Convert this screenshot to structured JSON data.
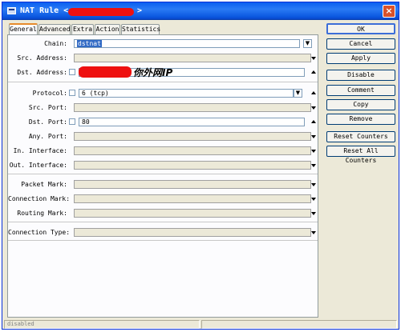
{
  "window": {
    "title": "NAT Rule <",
    "title_suffix": ">",
    "close_icon": "close-icon"
  },
  "tabs": [
    {
      "label": "General",
      "active": true
    },
    {
      "label": "Advanced",
      "active": false
    },
    {
      "label": "Extra",
      "active": false
    },
    {
      "label": "Action",
      "active": false
    },
    {
      "label": "Statistics",
      "active": false
    }
  ],
  "fields": {
    "chain": {
      "label": "Chain:",
      "value": "dstnat"
    },
    "src_address": {
      "label": "Src. Address:",
      "value": ""
    },
    "dst_address": {
      "label": "Dst. Address:",
      "value": "",
      "annotation": "你外网IP"
    },
    "protocol": {
      "label": "Protocol:",
      "value": "6 (tcp)"
    },
    "src_port": {
      "label": "Src. Port:",
      "value": ""
    },
    "dst_port": {
      "label": "Dst. Port:",
      "value": "80"
    },
    "any_port": {
      "label": "Any. Port:",
      "value": ""
    },
    "in_interface": {
      "label": "In. Interface:",
      "value": ""
    },
    "out_interface": {
      "label": "Out. Interface:",
      "value": ""
    },
    "packet_mark": {
      "label": "Packet Mark:",
      "value": ""
    },
    "connection_mark": {
      "label": "Connection Mark:",
      "value": ""
    },
    "routing_mark": {
      "label": "Routing Mark:",
      "value": ""
    },
    "connection_type": {
      "label": "Connection Type:",
      "value": ""
    }
  },
  "buttons": {
    "ok": "OK",
    "cancel": "Cancel",
    "apply": "Apply",
    "disable": "Disable",
    "comment": "Comment",
    "copy": "Copy",
    "remove": "Remove",
    "reset_counters": "Reset Counters",
    "reset_all_counters": "Reset All Counters"
  },
  "status": {
    "state": "disabled"
  },
  "colors": {
    "titlebar": "#0a5ff0",
    "redaction": "#ee1010",
    "selection": "#316ac5",
    "window_bg": "#ece9d8"
  }
}
